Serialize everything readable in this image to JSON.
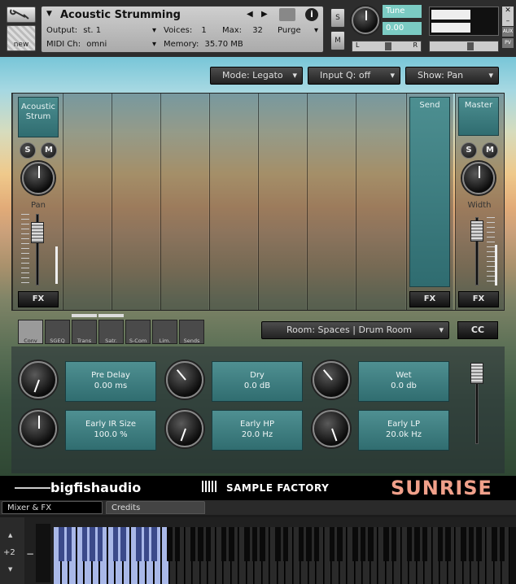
{
  "header": {
    "instrument_name": "Acoustic Strumming",
    "output_label": "Output:",
    "output_value": "st. 1",
    "voices_label": "Voices:",
    "voices_value": "1",
    "max_label": "Max:",
    "max_value": "32",
    "purge_label": "Purge",
    "midi_label": "MIDI Ch:",
    "midi_value": "omni",
    "memory_label": "Memory:",
    "memory_value": "35.70 MB",
    "solo_label": "S",
    "mute_label": "M",
    "tune_label": "Tune",
    "tune_value": "0.00",
    "pan_left": "L",
    "pan_right": "R",
    "aux_label": "AUX",
    "pv_label": "PV",
    "new_label": "new"
  },
  "toolbar": {
    "mode": "Mode: Legato",
    "input_q": "Input Q: off",
    "show": "Show: Pan"
  },
  "channels": {
    "acoustic": {
      "name": "Acoustic Strum",
      "solo": "S",
      "mute": "M",
      "knob_label": "Pan",
      "fx": "FX"
    },
    "send": {
      "name": "Send",
      "fx": "FX"
    },
    "master": {
      "name": "Master",
      "solo": "S",
      "mute": "M",
      "knob_label": "Width",
      "fx": "FX"
    }
  },
  "fx_tabs": [
    "Conv",
    "SGEQ",
    "Trans",
    "Satr.",
    "S-Com",
    "Lim.",
    "Sends"
  ],
  "room_select": "Room: Spaces | Drum Room",
  "cc_button": "CC",
  "params": [
    {
      "name": "Pre Delay",
      "value": "0.00 ms"
    },
    {
      "name": "Dry",
      "value": "0.0 dB"
    },
    {
      "name": "Wet",
      "value": "0.0 db"
    },
    {
      "name": "Early IR Size",
      "value": "100.0 %"
    },
    {
      "name": "Early HP",
      "value": "20.0 Hz"
    },
    {
      "name": "Early LP",
      "value": "20.0k Hz"
    }
  ],
  "branding": {
    "bigfish": "bigfishaudio",
    "sample_factory": "SAMPLE FACTORY",
    "sunrise": "SUNRISE"
  },
  "tabs": {
    "mixer": "Mixer & FX",
    "credits": "Credits"
  },
  "keyboard": {
    "octave": "+2",
    "minus": "−"
  },
  "colors": {
    "accent_teal": "#3f8588",
    "sunrise_pink": "#f0a08a"
  }
}
